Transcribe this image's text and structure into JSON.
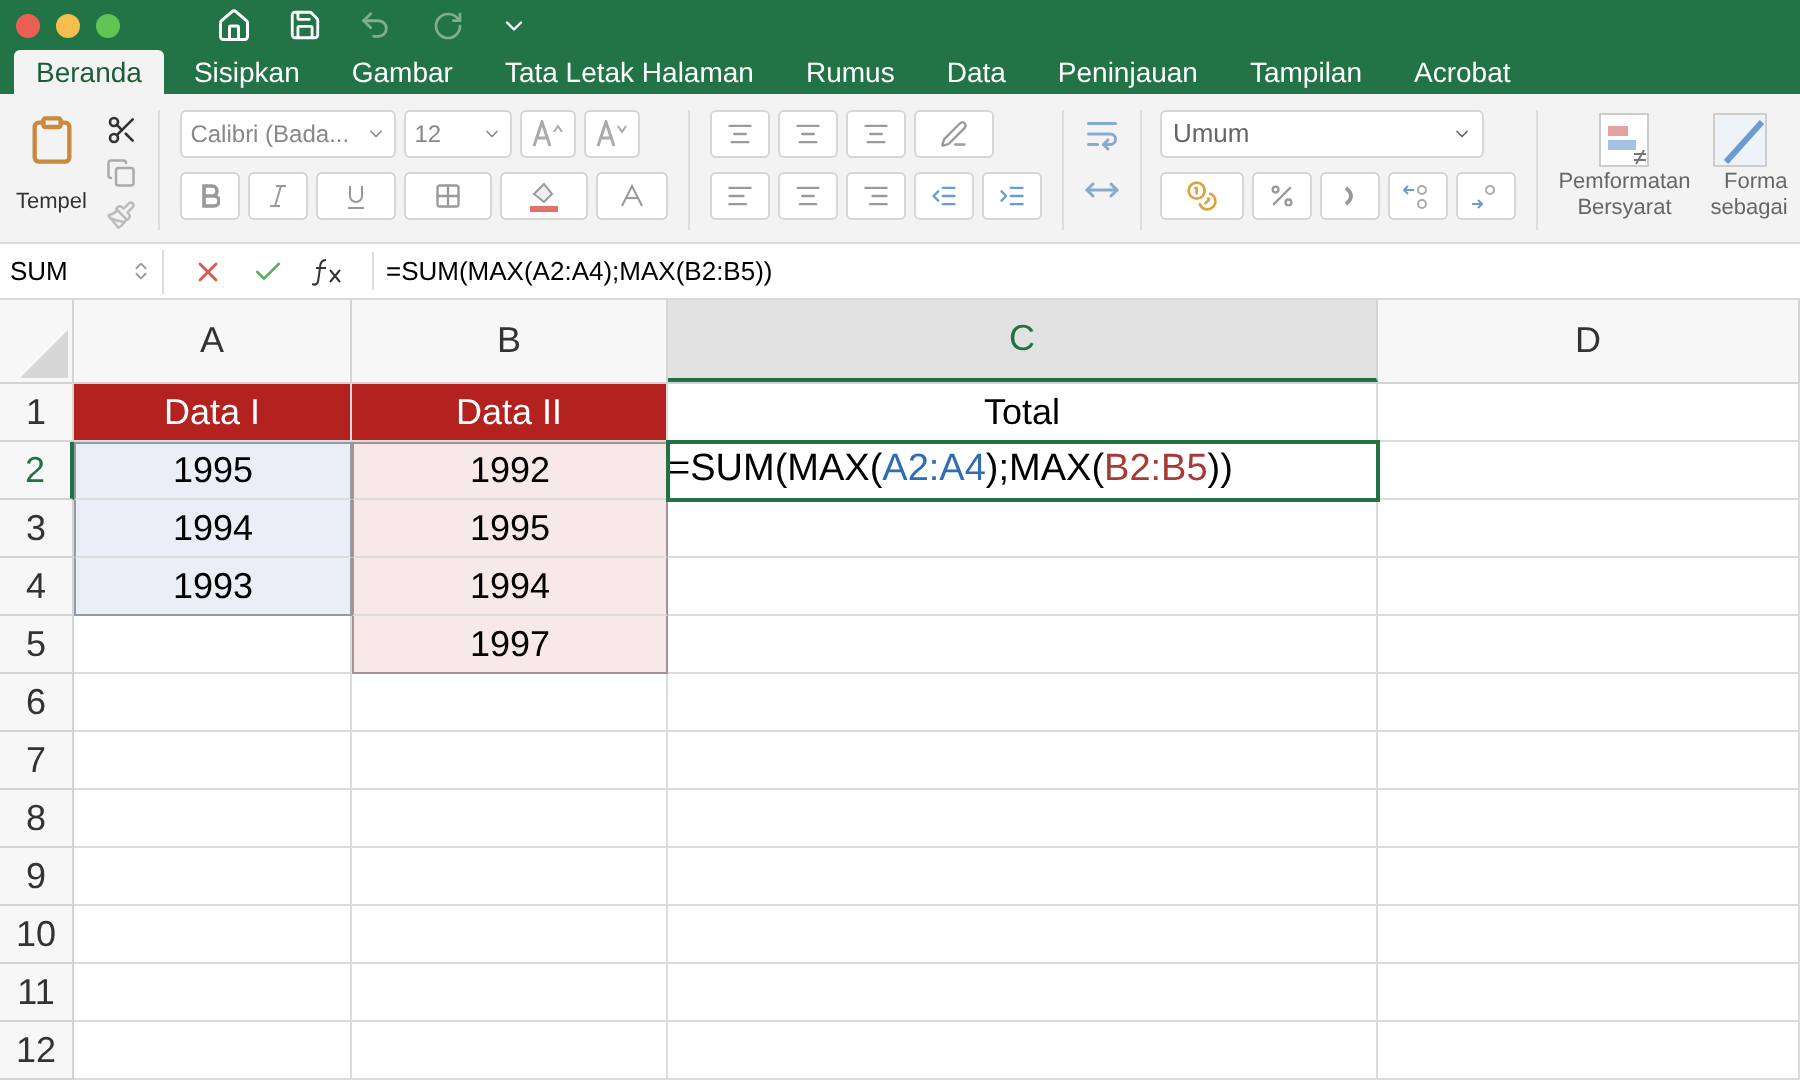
{
  "tabs": [
    {
      "label": "Beranda",
      "selected": true
    },
    {
      "label": "Sisipkan",
      "selected": false
    },
    {
      "label": "Gambar",
      "selected": false
    },
    {
      "label": "Tata Letak Halaman",
      "selected": false
    },
    {
      "label": "Rumus",
      "selected": false
    },
    {
      "label": "Data",
      "selected": false
    },
    {
      "label": "Peninjauan",
      "selected": false
    },
    {
      "label": "Tampilan",
      "selected": false
    },
    {
      "label": "Acrobat",
      "selected": false
    }
  ],
  "ribbon": {
    "paste_label": "Tempel",
    "font_name": "Calibri (Bada...",
    "font_size": "12",
    "number_format": "Umum",
    "conditional_format": [
      "Pemformatan",
      "Bersyarat"
    ],
    "format_table": [
      "Forma",
      "sebagai"
    ]
  },
  "formula_bar": {
    "name_box": "SUM",
    "formula": "=SUM(MAX(A2:A4);MAX(B2:B5))"
  },
  "sheet": {
    "columns": [
      {
        "label": "A",
        "selected": false
      },
      {
        "label": "B",
        "selected": false
      },
      {
        "label": "C",
        "selected": true
      },
      {
        "label": "D",
        "selected": false
      }
    ],
    "rows": [
      {
        "label": "1",
        "selected": false,
        "cells": [
          {
            "kind": "header",
            "text": "Data I",
            "selected": false
          },
          {
            "kind": "header",
            "text": "Data II",
            "selected": false
          },
          {
            "kind": "data",
            "text": "Total",
            "selected": false
          },
          {
            "kind": "empty",
            "selected": false
          }
        ]
      },
      {
        "label": "2",
        "selected": true,
        "cells": [
          {
            "kind": "data",
            "text": "1995",
            "color": "#e9eef7",
            "selected": false
          },
          {
            "kind": "data",
            "text": "1992",
            "color": "#f7e9e8",
            "selected": false
          },
          {
            "kind": "formula",
            "selected": true,
            "parts": [
              {
                "text": "=SUM(MAX(",
                "color": "#000000"
              },
              {
                "text": "A2:A4",
                "color": "#2f6db5"
              },
              {
                "text": ");MAX(",
                "color": "#000000"
              },
              {
                "text": "B2:B5",
                "color": "#a83a35"
              },
              {
                "text": "))",
                "color": "#000000"
              }
            ]
          },
          {
            "kind": "empty",
            "selected": false
          }
        ]
      },
      {
        "label": "3",
        "selected": false,
        "cells": [
          {
            "kind": "data",
            "text": "1994",
            "color": "#e9eef7",
            "selected": false
          },
          {
            "kind": "data",
            "text": "1995",
            "color": "#f7e9e8",
            "selected": false
          },
          {
            "kind": "empty",
            "selected": false
          },
          {
            "kind": "empty",
            "selected": false
          }
        ]
      },
      {
        "label": "4",
        "selected": false,
        "cells": [
          {
            "kind": "data",
            "text": "1993",
            "color": "#e9eef7",
            "selected": false
          },
          {
            "kind": "data",
            "text": "1994",
            "color": "#f7e9e8",
            "selected": false
          },
          {
            "kind": "empty",
            "selected": false
          },
          {
            "kind": "empty",
            "selected": false
          }
        ]
      },
      {
        "label": "5",
        "selected": false,
        "cells": [
          {
            "kind": "empty",
            "selected": false
          },
          {
            "kind": "data",
            "text": "1997",
            "color": "#f7e9e8",
            "selected": false
          },
          {
            "kind": "empty",
            "selected": false
          },
          {
            "kind": "empty",
            "selected": false
          }
        ]
      },
      {
        "label": "6",
        "selected": false
      },
      {
        "label": "7",
        "selected": false
      },
      {
        "label": "8",
        "selected": false
      },
      {
        "label": "9",
        "selected": false
      },
      {
        "label": "10",
        "selected": false
      },
      {
        "label": "11",
        "selected": false
      },
      {
        "label": "12",
        "selected": false
      }
    ]
  }
}
